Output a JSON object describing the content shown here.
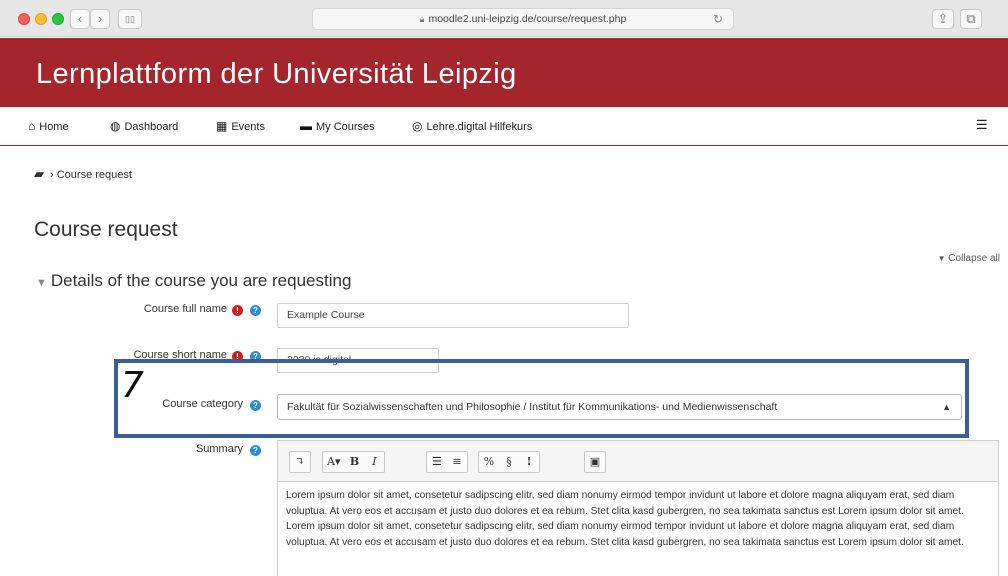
{
  "browser": {
    "url": "moodle2.uni-leipzig.de/course/request.php"
  },
  "header": {
    "title": "Lernplattform der Universität Leipzig"
  },
  "nav": {
    "items": [
      {
        "label": "Home",
        "icon": "home-icon"
      },
      {
        "label": "Dashboard",
        "icon": "dashboard-icon"
      },
      {
        "label": "Events",
        "icon": "calendar-icon"
      },
      {
        "label": "My Courses",
        "icon": "briefcase-icon"
      },
      {
        "label": "Lehre.digital Hilfekurs",
        "icon": "lifebuoy-icon"
      }
    ]
  },
  "breadcrumb": {
    "current": "Course request"
  },
  "page": {
    "title": "Course request",
    "collapse_all": "Collapse all",
    "section_title": "Details of the course you are requesting"
  },
  "form": {
    "full_name_label": "Course full name",
    "full_name_value": "Example Course",
    "short_name_label": "Course short name",
    "short_name_value": "2020 is digital",
    "category_label": "Course category",
    "category_value": "Fakultät für Sozialwissenschaften und Philosophie / Institut für Kommunikations- und Medienwissenschaft",
    "summary_label": "Summary",
    "summary_text": "Lorem ipsum dolor sit amet, consetetur sadipscing elitr, sed diam nonumy eirmod tempor invidunt ut labore et dolore magna aliquyam erat, sed diam voluptua. At vero eos et accusam et justo duo dolores et ea rebum. Stet clita kasd gubergren, no sea takimata sanctus est Lorem ipsum dolor sit amet. Lorem ipsum dolor sit amet, consetetur sadipscing elitr, sed diam nonumy eirmod tempor invidunt ut labore et dolore magna aliquyam erat, sed diam voluptua. At vero eos et accusam et justo duo dolores et ea rebum. Stet clita kasd gubergren, no sea takimata sanctus est Lorem ipsum dolor sit amet."
  },
  "annotation": {
    "step_number": "7"
  },
  "colors": {
    "brand_red": "#a4262c",
    "highlight_blue": "#3a5f95",
    "required_red": "#cc1f1f",
    "help_blue": "#2f8ccf"
  }
}
